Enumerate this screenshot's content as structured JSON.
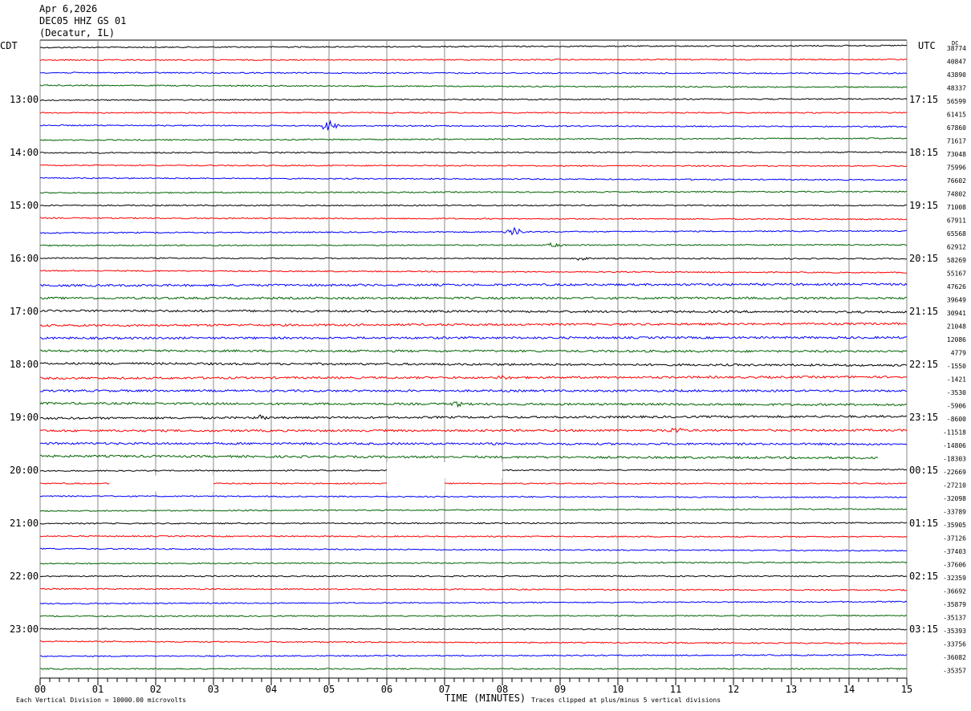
{
  "header": {
    "date": "Apr 6,2026",
    "station": "DEC05 HHZ GS 01",
    "location": "(Decatur, IL)"
  },
  "left_timezone": "CDT",
  "right_timezone": "UTC",
  "right_corner_label": "DC",
  "footer": {
    "xlabel": "TIME (MINUTES)",
    "scale_note": "Each Vertical Division = 10000.00 microvolts",
    "clip_note": "Traces clipped at plus/minus 5 vertical divisions"
  },
  "colors": {
    "cycle": [
      "#000000",
      "#ff0000",
      "#0000ff",
      "#006400"
    ],
    "grid": "#8a8a8a"
  },
  "chart_data": {
    "type": "line",
    "xlabel": "TIME (MINUTES)",
    "xlim": [
      0,
      15
    ],
    "x_ticks": [
      "00",
      "01",
      "02",
      "03",
      "04",
      "05",
      "06",
      "07",
      "08",
      "09",
      "10",
      "11",
      "12",
      "13",
      "14",
      "15"
    ],
    "left_hour_labels": [
      "13:00",
      "14:00",
      "15:00",
      "16:00",
      "17:00",
      "18:00",
      "19:00",
      "20:00",
      "21:00",
      "22:00",
      "23:00"
    ],
    "right_hour_labels": [
      "17:15",
      "18:15",
      "19:15",
      "20:15",
      "21:15",
      "22:15",
      "23:15",
      "00:15",
      "01:15",
      "02:15",
      "03:15"
    ],
    "trace_offsets": [
      38774,
      40847,
      43890,
      48337,
      56599,
      61415,
      67860,
      71617,
      73048,
      75996,
      76602,
      74802,
      71008,
      67911,
      65568,
      62912,
      58269,
      55167,
      47626,
      39649,
      30941,
      21048,
      12086,
      4779,
      -1550,
      -1421,
      -3530,
      -5906,
      -8600,
      -11518,
      -14806,
      -18303,
      -22669,
      -27210,
      -32098,
      -33789,
      -35905,
      -37126,
      -37403,
      -37606,
      -32359,
      -36692,
      -35879,
      -35137,
      -35393,
      -33756,
      -36082,
      -35357
    ],
    "events": [
      {
        "trace": 6,
        "minute": 5.0,
        "amplitude": 4
      },
      {
        "trace": 14,
        "minute": 8.2,
        "amplitude": 3
      },
      {
        "trace": 15,
        "minute": 8.9,
        "amplitude": 1.5
      },
      {
        "trace": 16,
        "minute": 9.4,
        "amplitude": 1.5
      },
      {
        "trace": 25,
        "minute": 8.0,
        "amplitude": 1.5
      },
      {
        "trace": 27,
        "minute": 7.2,
        "amplitude": 1.5
      },
      {
        "trace": 28,
        "minute": 3.8,
        "amplitude": 1.5
      },
      {
        "trace": 29,
        "minute": 11.0,
        "amplitude": 2
      }
    ],
    "gaps": [
      {
        "trace": 32,
        "start_minute": 6.0,
        "end_minute": 8.0
      },
      {
        "trace": 33,
        "start_minute": 1.2,
        "end_minute": 3.0
      },
      {
        "trace": 33,
        "start_minute": 6.0,
        "end_minute": 7.0
      }
    ],
    "partial_trace": {
      "trace": 31,
      "end_minute": 14.5
    }
  }
}
